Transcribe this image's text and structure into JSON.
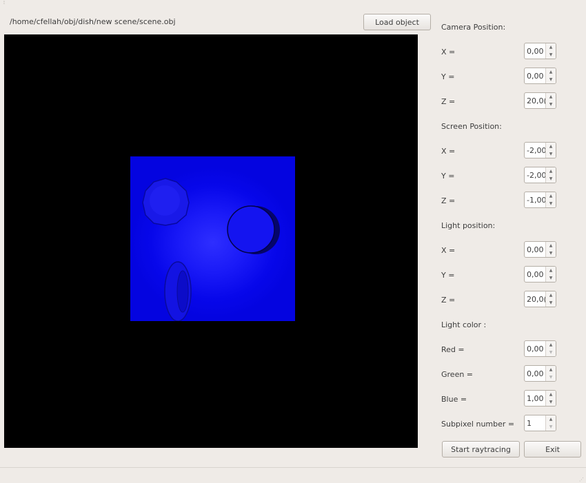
{
  "header": {
    "file_path": "/home/cfellah/obj/dish/new scene/scene.obj",
    "load_button": "Load object"
  },
  "camera": {
    "title": "Camera Position:",
    "x_label": "X =",
    "x_value": "0,00",
    "y_label": "Y =",
    "y_value": "0,00",
    "z_label": "Z =",
    "z_value": "20,0("
  },
  "screen": {
    "title": "Screen Position:",
    "x_label": "X =",
    "x_value": "-2,00",
    "y_label": "Y =",
    "y_value": "-2,00",
    "z_label": "Z =",
    "z_value": "-1,00"
  },
  "light": {
    "title": "Light position:",
    "x_label": "X =",
    "x_value": "0,00",
    "y_label": "Y =",
    "y_value": "0,00",
    "z_label": "Z =",
    "z_value": "20,0("
  },
  "light_color": {
    "title": "Light color :",
    "red_label": "Red =",
    "red_value": "0,00",
    "green_label": "Green =",
    "green_value": "0,00",
    "blue_label": "Blue =",
    "blue_value": "1,00"
  },
  "subpixel": {
    "label": "Subpixel number =",
    "value": "1"
  },
  "actions": {
    "start_label": "Start raytracing",
    "exit_label": "Exit"
  },
  "colors": {
    "window_bg": "#efebe7",
    "viewport_bg": "#000000",
    "scene_blue": "#0707ea"
  },
  "icons": {
    "spin_up": "chevron-up-icon",
    "spin_down": "chevron-down-icon"
  }
}
